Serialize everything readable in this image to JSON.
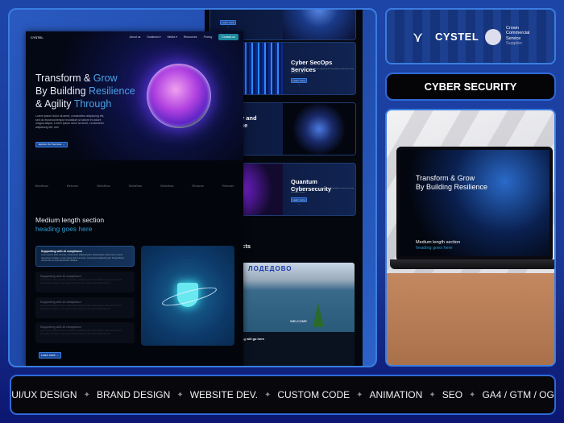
{
  "brand": {
    "name": "CYSTEL",
    "partner_lines": [
      "Crown",
      "Commercial",
      "Service",
      "Supplier"
    ]
  },
  "category": "CYBER SECURITY",
  "site": {
    "nav": [
      "About us",
      "Solutions ▾",
      "Media ▾",
      "Resources",
      "Pricing"
    ],
    "cta": "Contact us",
    "hero_title_lines": [
      [
        "Transform & ",
        "Grow"
      ],
      [
        "By Building ",
        "Resilience"
      ],
      [
        "& Agility ",
        "Through"
      ]
    ],
    "hero_text": "Lorem ipsum dolor sit amet, consectetur adipiscing elit, sed do eiusmod tempor incididunt ut labore et dolore magna aliqua. Lorem ipsum dolor sit amet, consectetur adipiscing elit, sed",
    "hero_button": "Explore Our Services →",
    "logos": [
      "Webflow",
      "Relume",
      "Webflow",
      "Webflow",
      "Webflow",
      "Relume",
      "Relume"
    ],
    "section_heading": [
      "Medium length section",
      "heading goes here"
    ],
    "features": [
      {
        "title": "Supporting with AI compliance",
        "text": "Lorem ipsum dolor sit amet, consectetur adipiscing elit. Suspendisse varius enim in eros elementum tristique. Lorem ipsum dolor sit amet, consectetur adipiscing elit. Suspendisse varius enim in eros elementum tristique."
      },
      {
        "title": "Supporting with AI compliance",
        "text": "Lorem ipsum dolor sit amet, consectetur adipiscing elit. Suspendisse varius enim in eros elementum tristique. Lorem ipsum dolor sit amet, consectetur adipiscing elit."
      },
      {
        "title": "Supporting with AI compliance",
        "text": "Lorem ipsum dolor sit amet, consectetur adipiscing elit. Suspendisse varius enim in eros elementum tristique. Lorem ipsum dolor sit amet, consectetur adipiscing elit."
      },
      {
        "title": "Supporting with AI compliance",
        "text": "Lorem ipsum dolor sit amet, consectetur adipiscing elit. Suspendisse varius enim in eros elementum tristique. Lorem ipsum dolor sit amet, consectetur adipiscing elit."
      }
    ],
    "learn_more": "Learn more →",
    "services": [
      {
        "title": "Cyber SecOps Services",
        "button": "Learn more →"
      },
      {
        "title": "y and\nce",
        "button": "Learn more →"
      },
      {
        "title": "Quantum Cybersecurity",
        "button": "Learn more →"
      }
    ],
    "service_text": "Lorem ipsum dolor sit amet, consectetur adipiscing elit. Suspendisse varius enim in eros elementum tristique.",
    "top_button": "Learn more →",
    "projects_heading": "jects",
    "project_sign": "ЛОДЕДОВО",
    "project_welcome": "WELCOME",
    "project_caption": "ng will go here"
  },
  "laptop": {
    "title_lines": [
      "Transform & Grow",
      "By Building Resilience"
    ],
    "section": "Medium length section",
    "section2": "heading goes here"
  },
  "skills": [
    "UI/UX DESIGN",
    "BRAND DESIGN",
    "WEBSITE DEV.",
    "CUSTOM CODE",
    "ANIMATION",
    "SEO",
    "GA4 / GTM / OG"
  ],
  "colors": {
    "accent": "#3a7de0",
    "highlight": "#4aa3e8",
    "background": "#1d45a8"
  }
}
